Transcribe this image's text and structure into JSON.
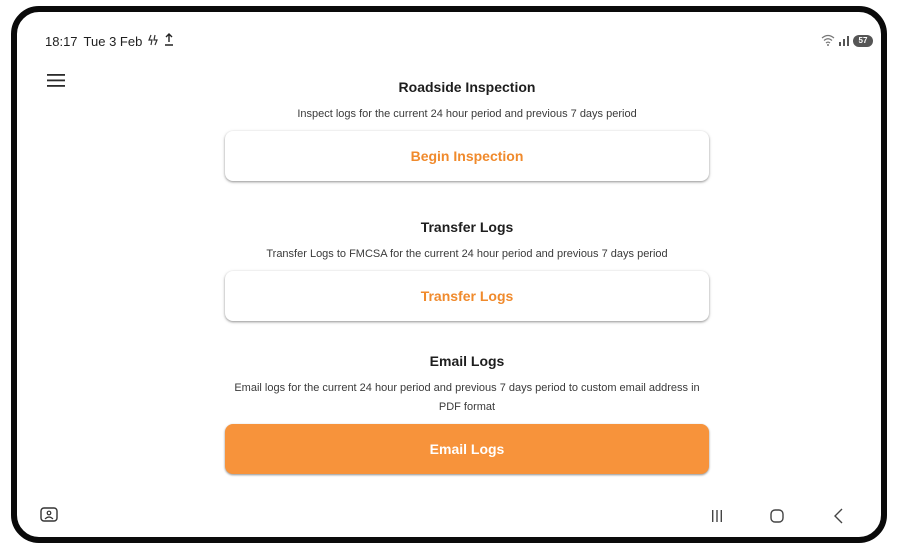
{
  "status_bar": {
    "time": "18:17",
    "date": "Tue 3 Feb",
    "battery": "57"
  },
  "sections": [
    {
      "title": "Roadside Inspection",
      "description": "Inspect logs for the current 24 hour period and previous 7 days period",
      "button_label": "Begin Inspection"
    },
    {
      "title": "Transfer Logs",
      "description": "Transfer Logs to FMCSA for the current 24 hour period and previous 7 days period",
      "button_label": "Transfer Logs"
    },
    {
      "title": "Email Logs",
      "description": "Email logs for the current 24 hour period and previous 7 days period to custom email address in PDF format",
      "button_label": "Email Logs"
    }
  ],
  "colors": {
    "accent": "#f7933b",
    "accent_text": "#f08a2c",
    "frame": "#0a0a0a"
  },
  "icons": {
    "menu": "hamburger-menu-icon",
    "nav_left": "screen-assist-icon",
    "recent": "recent-apps-icon",
    "home": "home-icon",
    "back": "back-icon"
  }
}
